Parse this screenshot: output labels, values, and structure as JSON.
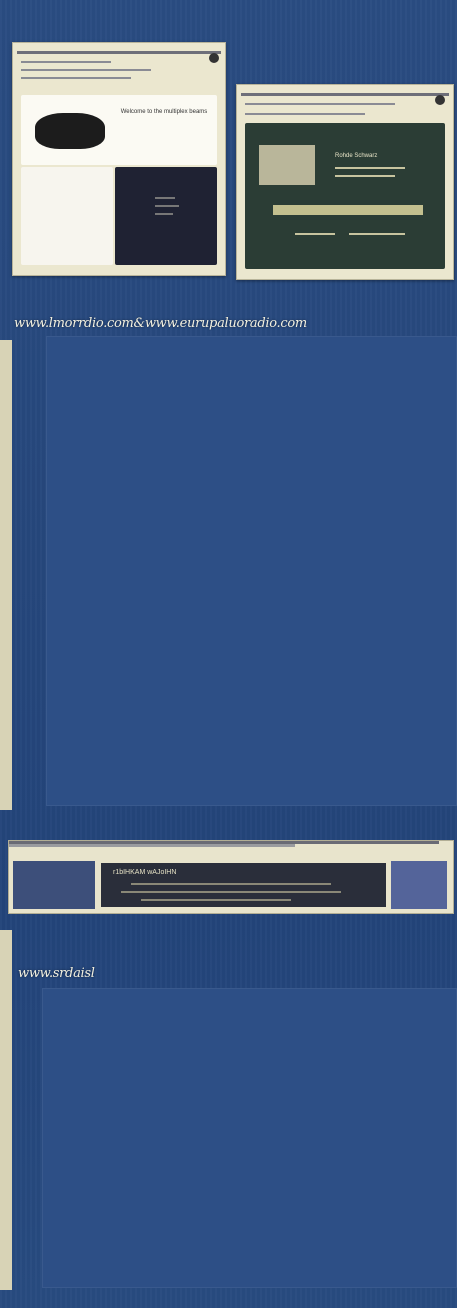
{
  "urls": {
    "top_caption": "www.lmorrdio.com&www.eurupaluoradio.com",
    "bottom_caption": "www.srdaisl"
  },
  "shots": {
    "left": {
      "headline": "Welcome to the multiplex beams"
    },
    "right": {
      "headline": "Rohde Schwarz"
    },
    "strip": {
      "title": "r1bIHKAM wAJoIHN"
    }
  },
  "colors": {
    "background": "#26477c",
    "shot_frame": "#ebe7cf"
  }
}
